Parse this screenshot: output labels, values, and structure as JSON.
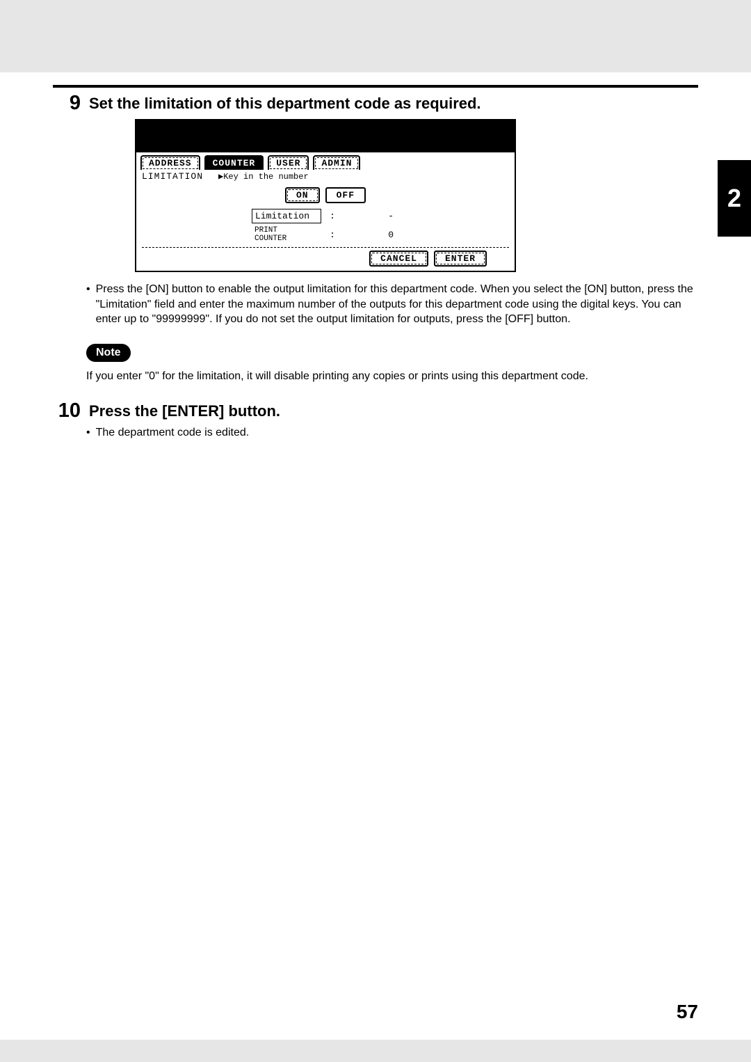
{
  "sideTab": "2",
  "pageNumber": "57",
  "step9": {
    "num": "9",
    "title": "Set the limitation of this department code as required.",
    "bulletMark": "•",
    "bullet": "Press the [ON] button to enable the output limitation for this department code. When you select the [ON] button, press the \"Limitation\" field and enter the maximum number of the outputs for this department code using the digital keys. You can enter up to \"99999999\". If you do not set the output limitation for outputs, press the [OFF] button."
  },
  "lcd": {
    "tabs": {
      "address": "ADDRESS",
      "counter": "COUNTER",
      "user": "USER",
      "admin": "ADMIN"
    },
    "label": "LIMITATION",
    "prompt": "▶Key in the number",
    "on": "ON",
    "off": "OFF",
    "limitationLabel": "Limitation",
    "limitationValue": "-",
    "printCounterLabel1": "PRINT",
    "printCounterLabel2": "COUNTER",
    "printCounterValue": "0",
    "cancel": "CANCEL",
    "enter": "ENTER"
  },
  "note": {
    "label": "Note",
    "text": "If you enter \"0\" for the limitation, it will disable printing any copies or prints using this department code."
  },
  "step10": {
    "num": "10",
    "title": "Press the [ENTER] button.",
    "bulletMark": "•",
    "bullet": "The department code is edited."
  }
}
